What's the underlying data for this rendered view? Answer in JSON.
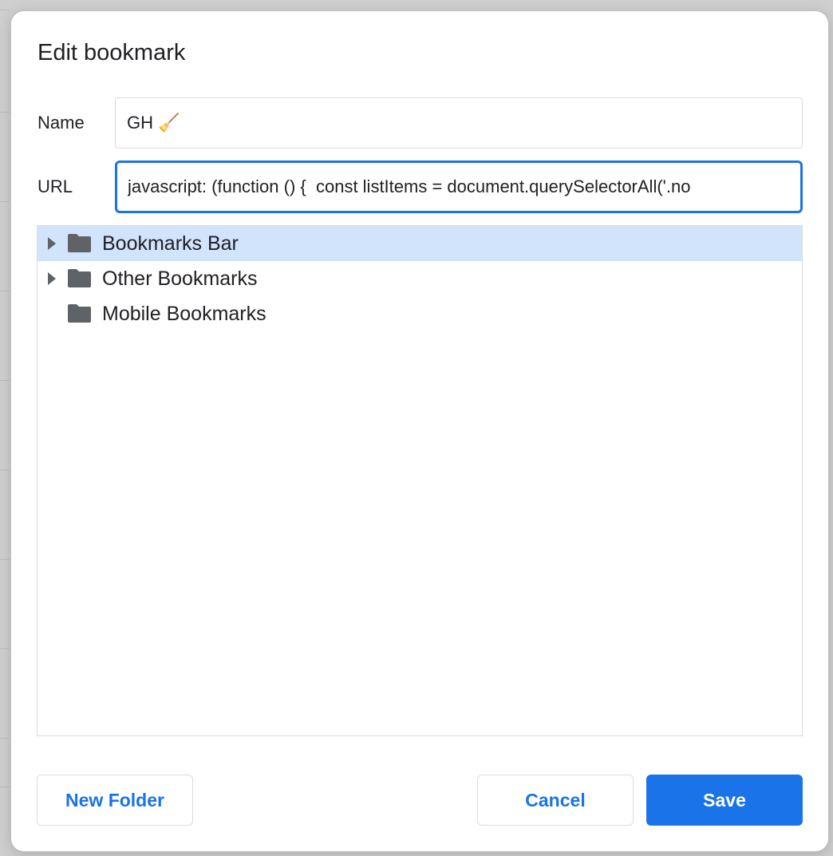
{
  "dialog": {
    "title": "Edit bookmark",
    "name_label": "Name",
    "name_value": "GH 🧹",
    "url_label": "URL",
    "url_value": "javascript: (function () {  const listItems = document.querySelectorAll('.no"
  },
  "folders": [
    {
      "label": "Bookmarks Bar",
      "expandable": true,
      "selected": true
    },
    {
      "label": "Other Bookmarks",
      "expandable": true,
      "selected": false
    },
    {
      "label": "Mobile Bookmarks",
      "expandable": false,
      "selected": false
    }
  ],
  "buttons": {
    "new_folder": "New Folder",
    "cancel": "Cancel",
    "save": "Save"
  },
  "colors": {
    "accent": "#1a73e8",
    "selected_row": "#d2e3fc",
    "folder_icon": "#5f6368"
  },
  "icons": {
    "folder": "folder-icon",
    "expand": "chevron-right-icon"
  }
}
